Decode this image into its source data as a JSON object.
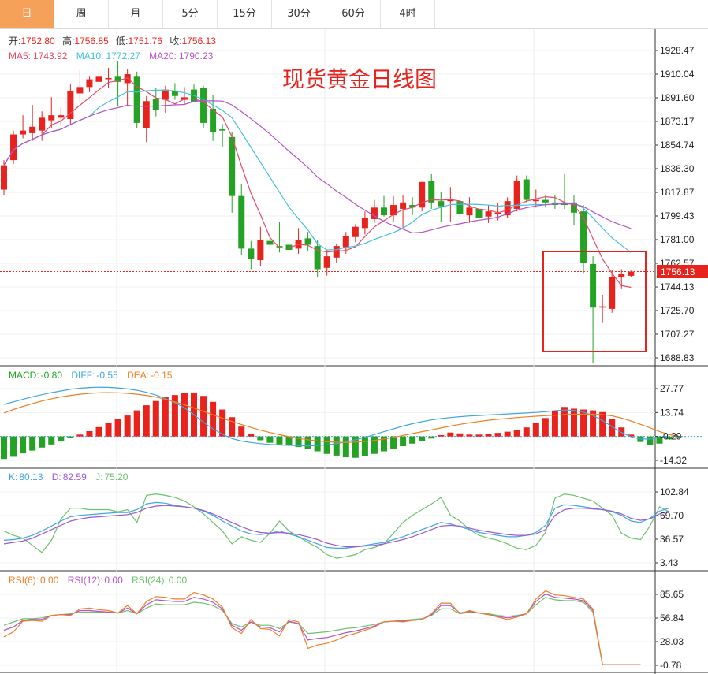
{
  "tabs": [
    "日",
    "周",
    "月",
    "5分",
    "15分",
    "30分",
    "60分",
    "4时"
  ],
  "active_tab": 0,
  "colors": {
    "up": "#e8231e",
    "down": "#23a223",
    "ma5": "#e14b6d",
    "ma10": "#43c1e0",
    "ma20": "#b452c8",
    "diff": "#3fa6e3",
    "dea": "#f07f24",
    "k": "#3fa6e3",
    "d": "#9b59d0",
    "j": "#6cc16c",
    "rsi6": "#f07f24",
    "rsi12": "#b452c8",
    "rsi24": "#6cc16c"
  },
  "ohlc": {
    "open_label": "开:",
    "open": "1752.80",
    "high_label": "高:",
    "high": "1756.85",
    "low_label": "低:",
    "low": "1751.76",
    "close_label": "收:",
    "close": "1756.13"
  },
  "ma": {
    "ma5_label": "MA5:",
    "ma5": "1743.92",
    "ma10_label": "MA10:",
    "ma10": "1772.27",
    "ma20_label": "MA20:",
    "ma20": "1790.23"
  },
  "annotation": "现货黄金日线图",
  "last_price_tag": "1756.13",
  "macd_legend": {
    "macd_label": "MACD:",
    "macd": "-0.80",
    "diff_label": "DIFF:",
    "diff": "-0.55",
    "dea_label": "DEA:",
    "dea": "-0.15"
  },
  "kdj_legend": {
    "k_label": "K:",
    "k": "80.13",
    "d_label": "D:",
    "d": "82.59",
    "j_label": "J:",
    "j": "75.20"
  },
  "rsi_legend": {
    "rsi6_label": "RSI(6):",
    "rsi6": "0.00",
    "rsi12_label": "RSI(12):",
    "rsi12": "0.00",
    "rsi24_label": "RSI(24):",
    "rsi24": "0.00"
  },
  "chart_data": [
    {
      "type": "candlestick",
      "y_ticks": [
        "1928.47",
        "1910.04",
        "1891.60",
        "1873.17",
        "1854.74",
        "1836.30",
        "1817.87",
        "1799.43",
        "1781.00",
        "1762.57",
        "1744.13",
        "1725.70",
        "1707.27",
        "1688.83"
      ],
      "ylim": [
        1688.83,
        1928.47
      ],
      "last_price": 1756.13,
      "candles": [
        {
          "o": 1820,
          "h": 1843,
          "l": 1816,
          "c": 1839
        },
        {
          "o": 1843,
          "h": 1866,
          "l": 1840,
          "c": 1863
        },
        {
          "o": 1863,
          "h": 1878,
          "l": 1860,
          "c": 1866
        },
        {
          "o": 1864,
          "h": 1886,
          "l": 1858,
          "c": 1869
        },
        {
          "o": 1866,
          "h": 1881,
          "l": 1858,
          "c": 1876
        },
        {
          "o": 1874,
          "h": 1892,
          "l": 1868,
          "c": 1878
        },
        {
          "o": 1876,
          "h": 1884,
          "l": 1870,
          "c": 1878
        },
        {
          "o": 1875,
          "h": 1902,
          "l": 1870,
          "c": 1897
        },
        {
          "o": 1895,
          "h": 1913,
          "l": 1888,
          "c": 1900
        },
        {
          "o": 1900,
          "h": 1908,
          "l": 1896,
          "c": 1906
        },
        {
          "o": 1904,
          "h": 1912,
          "l": 1900,
          "c": 1908
        },
        {
          "o": 1906,
          "h": 1915,
          "l": 1899,
          "c": 1907
        },
        {
          "o": 1908,
          "h": 1920,
          "l": 1885,
          "c": 1904
        },
        {
          "o": 1903,
          "h": 1914,
          "l": 1886,
          "c": 1910
        },
        {
          "o": 1908,
          "h": 1912,
          "l": 1868,
          "c": 1872
        },
        {
          "o": 1868,
          "h": 1893,
          "l": 1857,
          "c": 1889
        },
        {
          "o": 1891,
          "h": 1899,
          "l": 1877,
          "c": 1882
        },
        {
          "o": 1890,
          "h": 1901,
          "l": 1880,
          "c": 1898
        },
        {
          "o": 1897,
          "h": 1903,
          "l": 1890,
          "c": 1893
        },
        {
          "o": 1890,
          "h": 1900,
          "l": 1886,
          "c": 1892
        },
        {
          "o": 1898,
          "h": 1902,
          "l": 1888,
          "c": 1888
        },
        {
          "o": 1899,
          "h": 1901,
          "l": 1868,
          "c": 1872
        },
        {
          "o": 1883,
          "h": 1894,
          "l": 1858,
          "c": 1865
        },
        {
          "o": 1867,
          "h": 1871,
          "l": 1853,
          "c": 1866
        },
        {
          "o": 1861,
          "h": 1865,
          "l": 1802,
          "c": 1815
        },
        {
          "o": 1815,
          "h": 1824,
          "l": 1769,
          "c": 1774
        },
        {
          "o": 1774,
          "h": 1780,
          "l": 1758,
          "c": 1766
        },
        {
          "o": 1765,
          "h": 1791,
          "l": 1760,
          "c": 1781
        },
        {
          "o": 1780,
          "h": 1786,
          "l": 1773,
          "c": 1777
        },
        {
          "o": 1776,
          "h": 1795,
          "l": 1771,
          "c": 1775
        },
        {
          "o": 1777,
          "h": 1782,
          "l": 1769,
          "c": 1773
        },
        {
          "o": 1774,
          "h": 1790,
          "l": 1770,
          "c": 1781
        },
        {
          "o": 1782,
          "h": 1787,
          "l": 1772,
          "c": 1777
        },
        {
          "o": 1776,
          "h": 1781,
          "l": 1752,
          "c": 1758
        },
        {
          "o": 1759,
          "h": 1773,
          "l": 1753,
          "c": 1768
        },
        {
          "o": 1767,
          "h": 1778,
          "l": 1763,
          "c": 1776
        },
        {
          "o": 1775,
          "h": 1787,
          "l": 1770,
          "c": 1784
        },
        {
          "o": 1783,
          "h": 1793,
          "l": 1779,
          "c": 1791
        },
        {
          "o": 1790,
          "h": 1803,
          "l": 1785,
          "c": 1798
        },
        {
          "o": 1797,
          "h": 1812,
          "l": 1794,
          "c": 1806
        },
        {
          "o": 1806,
          "h": 1815,
          "l": 1799,
          "c": 1800
        },
        {
          "o": 1800,
          "h": 1815,
          "l": 1795,
          "c": 1808
        },
        {
          "o": 1805,
          "h": 1816,
          "l": 1790,
          "c": 1810
        },
        {
          "o": 1808,
          "h": 1814,
          "l": 1800,
          "c": 1806
        },
        {
          "o": 1806,
          "h": 1826,
          "l": 1803,
          "c": 1826
        },
        {
          "o": 1827,
          "h": 1832,
          "l": 1805,
          "c": 1810
        },
        {
          "o": 1811,
          "h": 1818,
          "l": 1795,
          "c": 1807
        },
        {
          "o": 1811,
          "h": 1822,
          "l": 1795,
          "c": 1812
        },
        {
          "o": 1811,
          "h": 1814,
          "l": 1799,
          "c": 1801
        },
        {
          "o": 1800,
          "h": 1814,
          "l": 1794,
          "c": 1806
        },
        {
          "o": 1805,
          "h": 1810,
          "l": 1795,
          "c": 1798
        },
        {
          "o": 1799,
          "h": 1808,
          "l": 1794,
          "c": 1803
        },
        {
          "o": 1801,
          "h": 1810,
          "l": 1796,
          "c": 1802
        },
        {
          "o": 1800,
          "h": 1814,
          "l": 1798,
          "c": 1811
        },
        {
          "o": 1805,
          "h": 1831,
          "l": 1803,
          "c": 1827
        },
        {
          "o": 1828,
          "h": 1831,
          "l": 1810,
          "c": 1812
        },
        {
          "o": 1811,
          "h": 1820,
          "l": 1806,
          "c": 1812
        },
        {
          "o": 1812,
          "h": 1816,
          "l": 1806,
          "c": 1810
        },
        {
          "o": 1810,
          "h": 1816,
          "l": 1805,
          "c": 1808
        },
        {
          "o": 1810,
          "h": 1832,
          "l": 1805,
          "c": 1808
        },
        {
          "o": 1810,
          "h": 1816,
          "l": 1792,
          "c": 1802
        },
        {
          "o": 1803,
          "h": 1808,
          "l": 1755,
          "c": 1763
        },
        {
          "o": 1762,
          "h": 1768,
          "l": 1685,
          "c": 1728
        },
        {
          "o": 1728,
          "h": 1738,
          "l": 1716,
          "c": 1729
        },
        {
          "o": 1727,
          "h": 1757,
          "l": 1724,
          "c": 1752
        },
        {
          "o": 1752,
          "h": 1758,
          "l": 1743,
          "c": 1754
        },
        {
          "o": 1752.8,
          "h": 1756.85,
          "l": 1751.76,
          "c": 1756.13
        }
      ]
    },
    {
      "type": "bar",
      "name": "MACD",
      "y_ticks": [
        "27.77",
        "13.74",
        "-0.29",
        "-14.32"
      ],
      "ylim": [
        -14.32,
        27.77
      ],
      "values": [
        -13.5,
        -12.2,
        -10.2,
        -8.6,
        -6.8,
        -5.0,
        -3.0,
        -1.0,
        0.8,
        2.8,
        5.2,
        7.5,
        9.8,
        12.0,
        15.0,
        18.0,
        20.5,
        22.8,
        24.0,
        25.0,
        25.5,
        23.5,
        20.0,
        15.5,
        11.0,
        5.5,
        1.2,
        -2.5,
        -4.0,
        -5.0,
        -5.5,
        -6.5,
        -7.8,
        -9.0,
        -10.5,
        -11.5,
        -12.5,
        -12.8,
        -12.0,
        -10.5,
        -9.0,
        -7.5,
        -6.0,
        -4.5,
        -3.0,
        -1.5,
        0.5,
        2.0,
        1.5,
        0.8,
        0.8,
        1.0,
        1.8,
        2.5,
        3.5,
        5.0,
        7.5,
        10.5,
        14.5,
        17.0,
        16.0,
        15.5,
        15.0,
        14.0,
        10.0,
        5.0,
        0.8,
        -3.5,
        -5.5,
        -4.5,
        -2.0,
        -0.5
      ],
      "diff": [
        18.5,
        20.0,
        21.5,
        23.0,
        24.2,
        25.4,
        26.4,
        27.4,
        28.0,
        28.4,
        28.6,
        28.5,
        28.2,
        27.6,
        26.8,
        25.6,
        24.0,
        22.0,
        19.5,
        16.5,
        12.5,
        8.0,
        4.2,
        1.0,
        -1.5,
        -3.0,
        -3.8,
        -4.5,
        -5.0,
        -5.3,
        -5.5,
        -5.7,
        -5.8,
        -5.6,
        -5.2,
        -4.5,
        -3.5,
        -2.2,
        -0.8,
        0.8,
        2.5,
        4.2,
        5.8,
        7.2,
        8.4,
        9.4,
        10.2,
        10.8,
        11.3,
        11.7,
        12.0,
        12.3,
        12.6,
        12.9,
        13.2,
        13.5,
        13.8,
        14.2,
        14.8,
        15.2,
        15.0,
        14.0,
        12.0,
        9.0,
        5.5,
        2.0,
        -0.5,
        -1.8,
        -1.8,
        -1.0,
        -0.55
      ],
      "dea": [
        13.5,
        15.5,
        17.3,
        19.0,
        20.5,
        21.8,
        22.9,
        23.8,
        24.5,
        25.0,
        25.3,
        25.4,
        25.3,
        25.0,
        24.5,
        23.8,
        22.8,
        21.5,
        20.0,
        18.3,
        16.4,
        14.4,
        12.4,
        10.4,
        8.5,
        6.7,
        5.0,
        3.4,
        2.0,
        0.7,
        -0.4,
        -1.4,
        -2.2,
        -2.9,
        -3.4,
        -3.7,
        -3.8,
        -3.6,
        -3.2,
        -2.6,
        -1.8,
        -0.8,
        0.3,
        1.4,
        2.5,
        3.6,
        4.7,
        5.8,
        6.8,
        7.7,
        8.5,
        9.2,
        9.8,
        10.3,
        10.8,
        11.2,
        11.6,
        11.9,
        12.2,
        12.5,
        12.7,
        12.8,
        12.8,
        12.5,
        11.8,
        10.5,
        8.8,
        6.8,
        4.8,
        2.6,
        0.8,
        -0.15
      ]
    },
    {
      "type": "line",
      "name": "KDJ",
      "y_ticks": [
        "102.84",
        "69.70",
        "36.57",
        "3.43"
      ],
      "ylim": [
        3.43,
        102.84
      ],
      "k": [
        35,
        36,
        38,
        42,
        48,
        55,
        62,
        68,
        70,
        71,
        72,
        73,
        74,
        74,
        78,
        86,
        88,
        87,
        84,
        82,
        80,
        76,
        70,
        62,
        55,
        48,
        44,
        43,
        45,
        48,
        44,
        40,
        35,
        30,
        25,
        24,
        24,
        26,
        28,
        30,
        32,
        36,
        40,
        45,
        50,
        55,
        60,
        58,
        54,
        50,
        46,
        44,
        42,
        40,
        40,
        42,
        46,
        56,
        80,
        85,
        84,
        82,
        80,
        78,
        75,
        70,
        62,
        60,
        66,
        76,
        80
      ],
      "d": [
        30,
        32,
        34,
        38,
        44,
        50,
        56,
        62,
        65,
        67,
        68,
        69,
        70,
        71,
        74,
        80,
        83,
        84,
        83,
        82,
        80,
        77,
        72,
        66,
        60,
        54,
        49,
        46,
        45,
        46,
        45,
        43,
        40,
        36,
        31,
        28,
        26,
        26,
        27,
        28,
        30,
        33,
        36,
        40,
        45,
        50,
        55,
        56,
        55,
        52,
        49,
        47,
        45,
        43,
        42,
        42,
        44,
        50,
        70,
        78,
        80,
        80,
        79,
        78,
        76,
        72,
        66,
        63,
        65,
        72,
        76
      ],
      "j": [
        48,
        42,
        38,
        28,
        18,
        35,
        65,
        80,
        80,
        78,
        78,
        78,
        75,
        78,
        60,
        98,
        100,
        98,
        95,
        90,
        82,
        72,
        60,
        48,
        30,
        40,
        35,
        32,
        45,
        62,
        48,
        40,
        32,
        25,
        15,
        10,
        12,
        15,
        22,
        25,
        30,
        45,
        60,
        70,
        78,
        86,
        95,
        70,
        62,
        50,
        42,
        38,
        35,
        30,
        24,
        22,
        28,
        46,
        94,
        100,
        98,
        94,
        90,
        80,
        70,
        45,
        38,
        36,
        55,
        82,
        75
      ]
    },
    {
      "type": "line",
      "name": "RSI",
      "y_ticks": [
        "85.65",
        "56.84",
        "28.03",
        "-0.78"
      ],
      "ylim": [
        -0.78,
        85.65
      ],
      "rsi6": [
        34,
        40,
        53,
        54,
        53,
        60,
        61,
        60,
        68,
        69,
        67,
        66,
        63,
        72,
        62,
        77,
        83,
        82,
        80,
        80,
        88,
        85,
        80,
        70,
        45,
        38,
        55,
        44,
        43,
        35,
        55,
        52,
        20,
        24,
        26,
        30,
        35,
        38,
        42,
        46,
        52,
        53,
        52,
        54,
        55,
        62,
        75,
        75,
        62,
        66,
        63,
        61,
        58,
        55,
        58,
        62,
        80,
        90,
        85,
        84,
        82,
        80,
        68,
        0,
        0,
        0,
        0,
        0
      ],
      "rsi12": [
        42,
        46,
        54,
        55,
        55,
        60,
        61,
        61,
        66,
        66,
        65,
        64,
        63,
        69,
        62,
        73,
        79,
        78,
        77,
        77,
        82,
        80,
        76,
        68,
        48,
        42,
        52,
        46,
        45,
        40,
        53,
        50,
        30,
        32,
        33,
        36,
        39,
        41,
        44,
        47,
        52,
        53,
        53,
        54,
        55,
        61,
        72,
        72,
        63,
        65,
        63,
        61,
        59,
        57,
        59,
        62,
        77,
        86,
        82,
        81,
        80,
        78,
        66,
        0,
        0,
        0,
        0,
        0
      ],
      "rsi24": [
        48,
        52,
        56,
        56,
        57,
        60,
        61,
        62,
        64,
        64,
        64,
        64,
        63,
        66,
        62,
        69,
        74,
        73,
        73,
        73,
        76,
        75,
        72,
        66,
        50,
        46,
        52,
        48,
        48,
        44,
        52,
        50,
        38,
        39,
        40,
        42,
        44,
        45,
        47,
        49,
        52,
        53,
        54,
        55,
        56,
        60,
        68,
        68,
        62,
        64,
        63,
        62,
        60,
        59,
        60,
        62,
        73,
        82,
        79,
        78,
        78,
        76,
        64,
        0,
        0,
        0,
        0,
        0
      ]
    }
  ]
}
